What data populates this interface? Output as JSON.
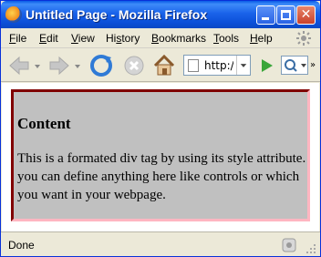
{
  "window": {
    "title": "Untitled Page - Mozilla Firefox",
    "title_icon": "firefox-icon",
    "controls": [
      "minimize",
      "maximize",
      "close"
    ]
  },
  "menu": {
    "items": [
      {
        "label": "File",
        "accel": "F"
      },
      {
        "label": "Edit",
        "accel": "E"
      },
      {
        "label": "View",
        "accel": "V"
      },
      {
        "label": "History",
        "accel": "s"
      },
      {
        "label": "Bookmarks",
        "accel": "B"
      },
      {
        "label": "Tools",
        "accel": "T"
      },
      {
        "label": "Help",
        "accel": "H"
      }
    ]
  },
  "toolbar": {
    "url": "http:/",
    "icons": [
      "back-icon",
      "forward-icon",
      "reload-icon",
      "stop-icon",
      "home-icon",
      "go-icon",
      "search-engine-icon"
    ]
  },
  "page": {
    "heading": "Content",
    "body": "This is a formated div tag by using its style attribute. you can define anything here like controls or which you want in your webpage.",
    "box_background": "#c0c0c0",
    "box_border_dark": "#800000",
    "box_border_light": "#ffb6c1"
  },
  "status": {
    "text": "Done"
  },
  "colors": {
    "titlebar": "#0b4fd8",
    "chrome": "#ece9d8"
  }
}
